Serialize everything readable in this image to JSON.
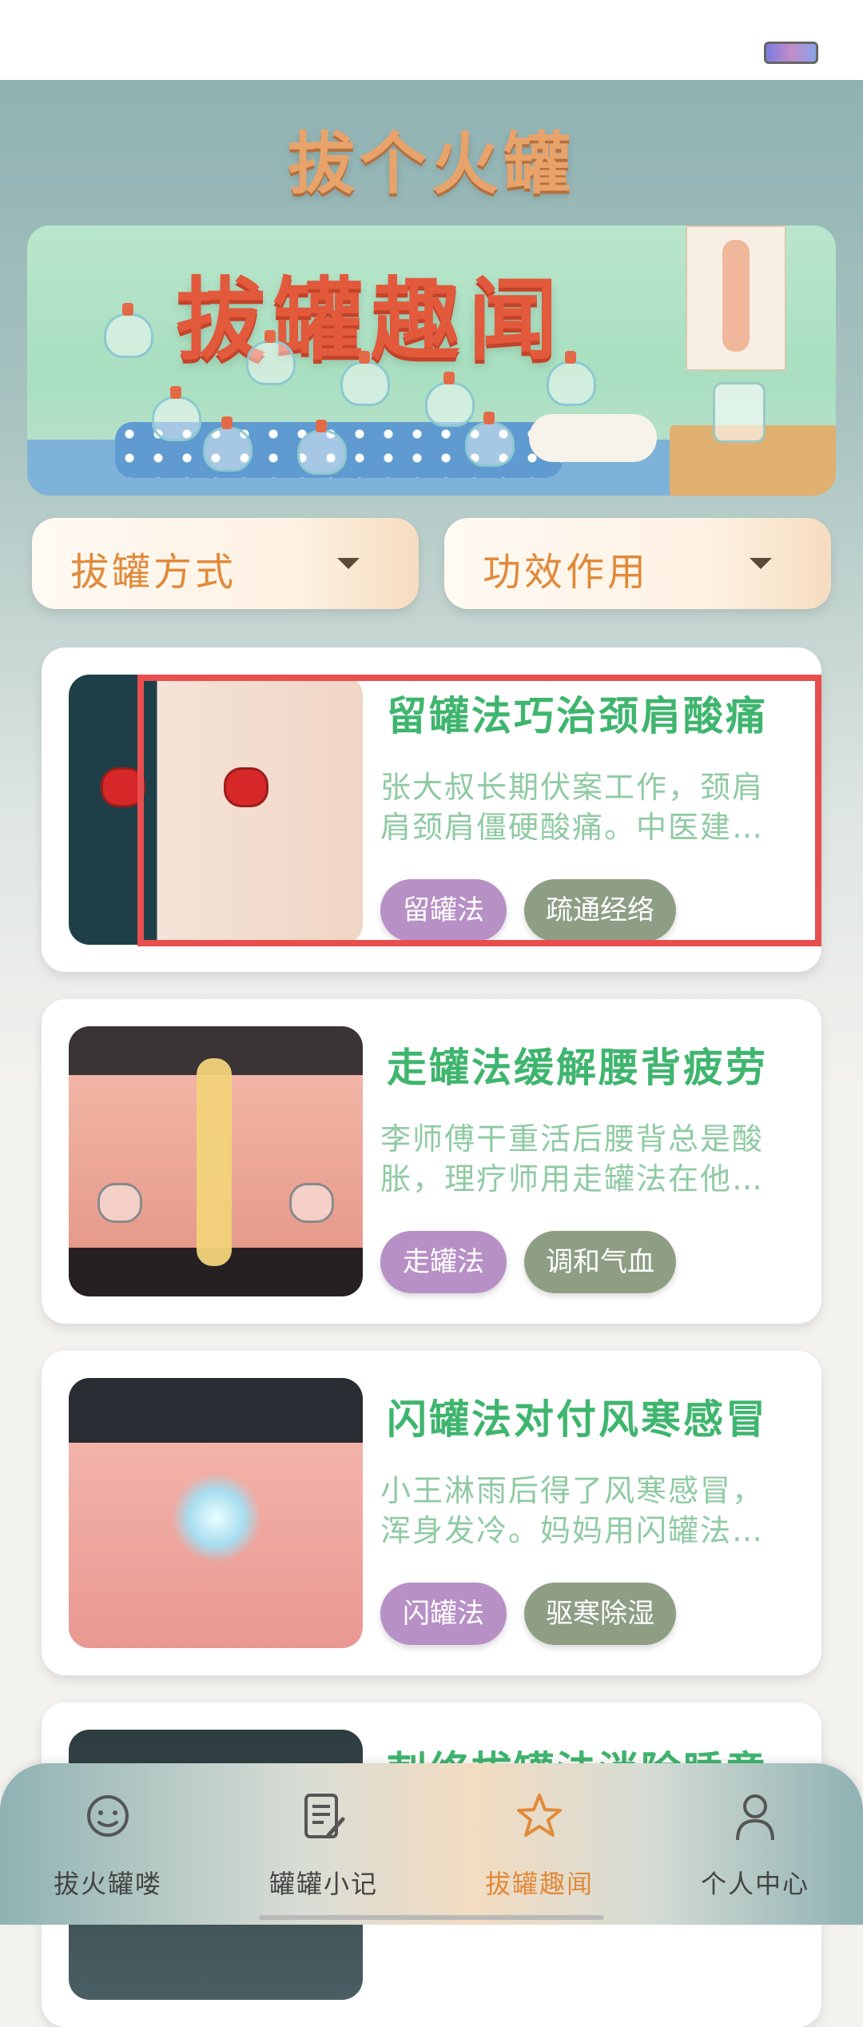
{
  "app": {
    "logo_text": "拔个火罐"
  },
  "banner": {
    "title": "拔罐趣闻"
  },
  "filters": [
    {
      "label": "拔罐方式"
    },
    {
      "label": "功效作用"
    }
  ],
  "articles": [
    {
      "title": "留罐法巧治颈肩酸痛",
      "desc_line1": "张大叔长期伏案工作，颈肩",
      "desc_line2": "肩颈肩僵硬酸痛。中医建…",
      "tags": [
        "留罐法",
        "疏通经络"
      ]
    },
    {
      "title": "走罐法缓解腰背疲劳",
      "desc_line1": "李师傅干重活后腰背总是酸",
      "desc_line2": "胀，理疗师用走罐法在他…",
      "tags": [
        "走罐法",
        "调和气血"
      ]
    },
    {
      "title": "闪罐法对付风寒感冒",
      "desc_line1": "小王淋雨后得了风寒感冒，",
      "desc_line2": "浑身发冷。妈妈用闪罐法…",
      "tags": [
        "闪罐法",
        "驱寒除湿"
      ]
    },
    {
      "title": "刺络拔罐法消除睡意",
      "desc_line1": "",
      "desc_line2": "",
      "tags": []
    }
  ],
  "tabbar": {
    "items": [
      {
        "label": "拔火罐喽",
        "icon": "smiley-face-icon"
      },
      {
        "label": "罐罐小记",
        "icon": "notepad-pen-icon"
      },
      {
        "label": "拔罐趣闻",
        "icon": "star-icon",
        "active": true
      },
      {
        "label": "个人中心",
        "icon": "person-icon"
      }
    ]
  },
  "colors": {
    "accent": "#e08a3a",
    "title_green": "#3fb56e",
    "tag_purple": "#b790c6",
    "tag_gray_green": "#8e9e85",
    "highlight_red": "#e94e4e"
  }
}
